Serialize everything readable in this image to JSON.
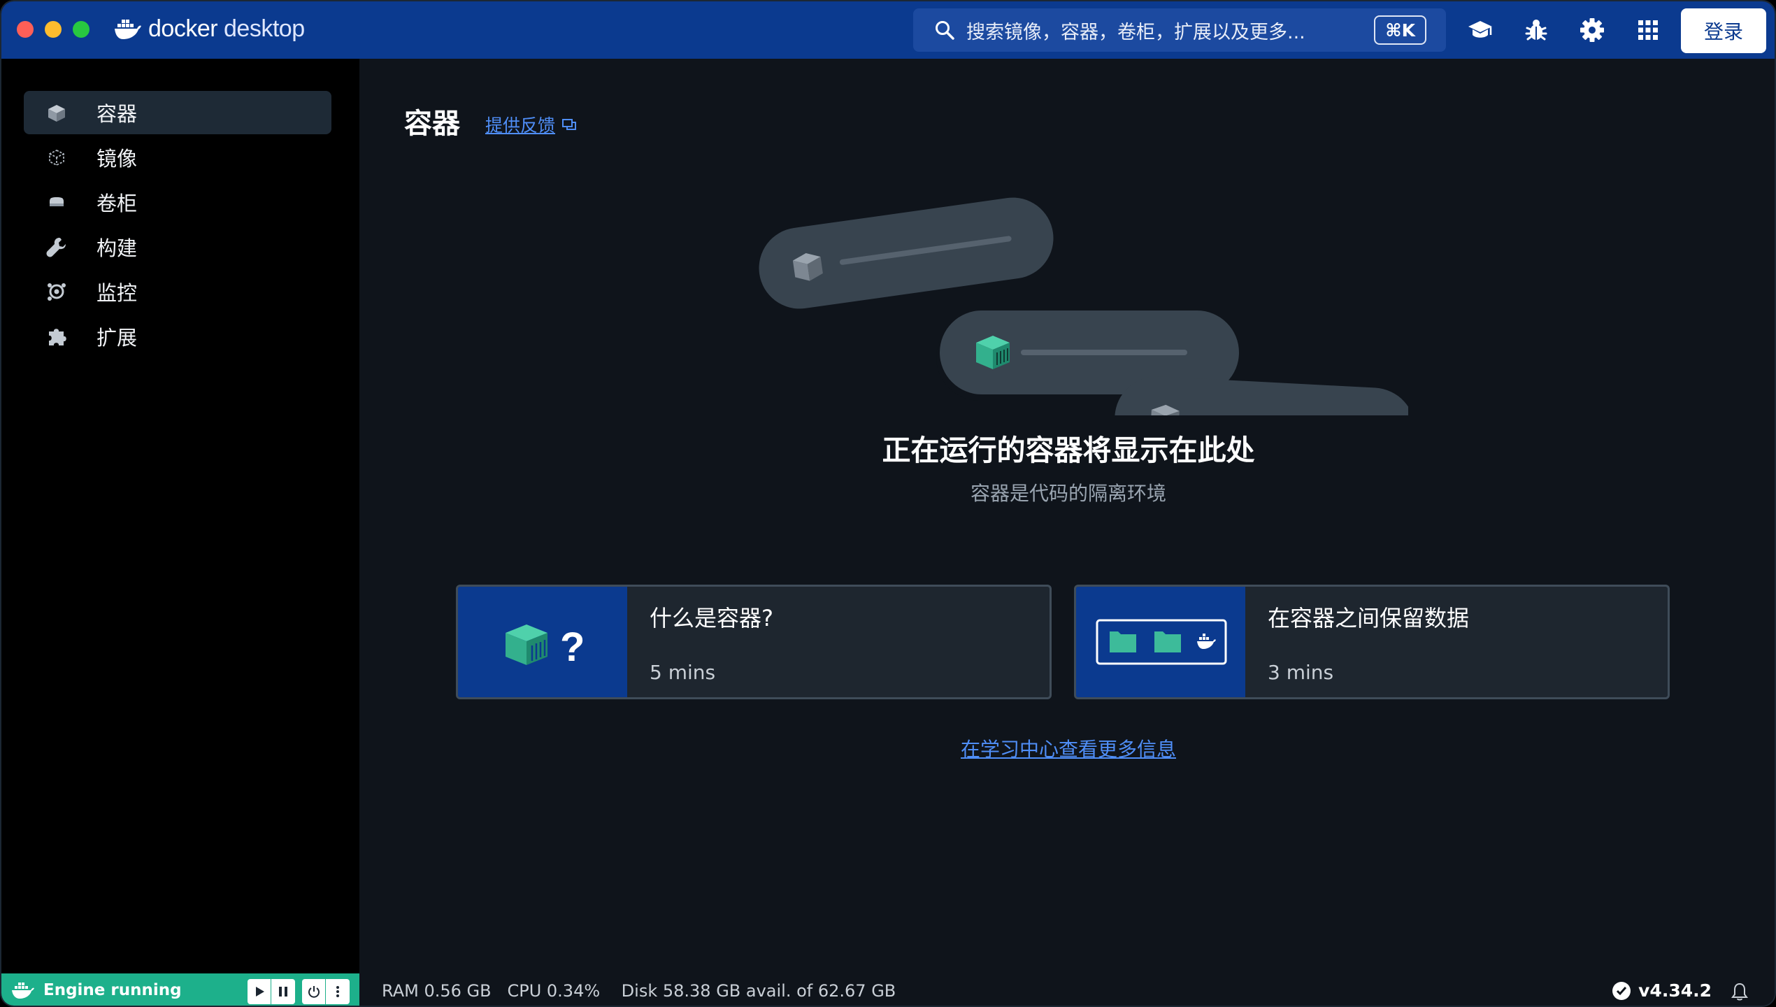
{
  "app": {
    "brand_primary": "docker",
    "brand_secondary": "desktop"
  },
  "header": {
    "search_placeholder": "搜索镜像，容器，卷柜，扩展以及更多...",
    "shortcut": "⌘K",
    "login_label": "登录",
    "icons": [
      "learning-center-icon",
      "troubleshoot-icon",
      "settings-icon",
      "apps-grid-icon"
    ]
  },
  "sidebar": {
    "items": [
      {
        "label": "容器",
        "icon": "container-icon",
        "active": true
      },
      {
        "label": "镜像",
        "icon": "image-icon",
        "active": false
      },
      {
        "label": "卷柜",
        "icon": "volume-icon",
        "active": false
      },
      {
        "label": "构建",
        "icon": "build-wrench-icon",
        "active": false
      },
      {
        "label": "监控",
        "icon": "monitor-icon",
        "active": false
      },
      {
        "label": "扩展",
        "icon": "extension-puzzle-icon",
        "active": false
      }
    ]
  },
  "main": {
    "title": "容器",
    "feedback_link": "提供反馈",
    "empty_title": "正在运行的容器将显示在此处",
    "empty_subtitle": "容器是代码的隔离环境",
    "cards": [
      {
        "title": "什么是容器?",
        "duration": "5 mins"
      },
      {
        "title": "在容器之间保留数据",
        "duration": "3 mins"
      }
    ],
    "learn_more": "在学习中心查看更多信息"
  },
  "statusbar": {
    "engine_status": "Engine running",
    "ram": "RAM 0.56 GB",
    "cpu": "CPU 0.34%",
    "disk": "Disk 58.38 GB avail. of 62.67 GB",
    "version": "v4.34.2"
  },
  "colors": {
    "titlebar": "#0b3a8f",
    "accent_link": "#4f8ef7",
    "engine_green": "#1db08b",
    "container_teal": "#3dbb9a"
  }
}
